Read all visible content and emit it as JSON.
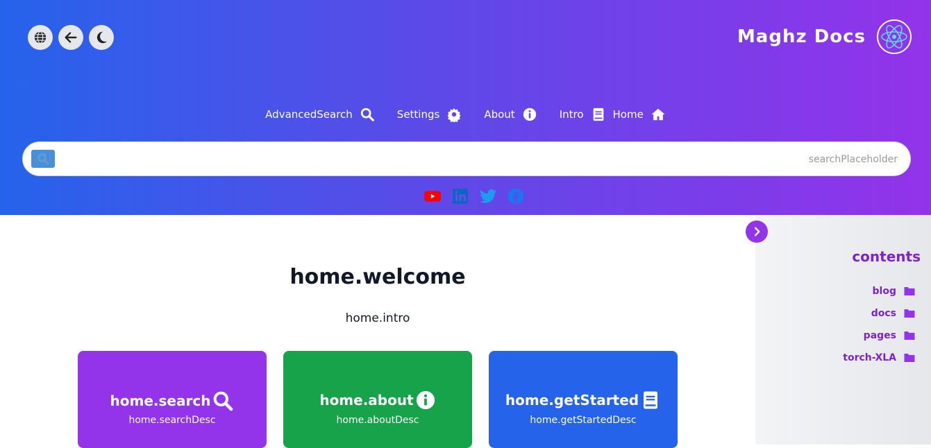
{
  "header": {
    "brand": "Maghz Docs",
    "icons": [
      "globe-icon",
      "arrow-left-icon",
      "moon-icon"
    ]
  },
  "nav": [
    {
      "label": "AdvancedSearch",
      "icon": "search-icon"
    },
    {
      "label": "Settings",
      "icon": "gear-icon"
    },
    {
      "label": "About",
      "icon": "info-icon"
    },
    {
      "label": "Intro",
      "icon": "book-icon"
    },
    {
      "label": "Home",
      "icon": "home-icon"
    }
  ],
  "search": {
    "placeholder": "searchPlaceholder",
    "value": ""
  },
  "social": [
    "youtube-icon",
    "linkedin-icon",
    "twitter-icon",
    "facebook-icon"
  ],
  "main": {
    "title": "home.welcome",
    "intro": "home.intro",
    "cards": [
      {
        "title": "home.search",
        "desc": "home.searchDesc",
        "color": "#9333ea",
        "icon": "search-icon"
      },
      {
        "title": "home.about",
        "desc": "home.aboutDesc",
        "color": "#16a34a",
        "icon": "info-icon"
      },
      {
        "title": "home.getStarted",
        "desc": "home.getStartedDesc",
        "color": "#2563eb",
        "icon": "book-icon"
      }
    ]
  },
  "sidebar": {
    "title": "contents",
    "items": [
      {
        "label": "blog",
        "icon": "folder-icon"
      },
      {
        "label": "docs",
        "icon": "folder-icon"
      },
      {
        "label": "pages",
        "icon": "folder-icon"
      },
      {
        "label": "torch-XLA",
        "icon": "folder-icon"
      }
    ]
  },
  "colors": {
    "gradient_start": "#2563eb",
    "gradient_end": "#9333ea",
    "accent": "#7e22ce",
    "youtube": "#ff0000",
    "linkedin": "#0a66c2",
    "twitter": "#1d9bf0",
    "facebook": "#1877f2"
  }
}
